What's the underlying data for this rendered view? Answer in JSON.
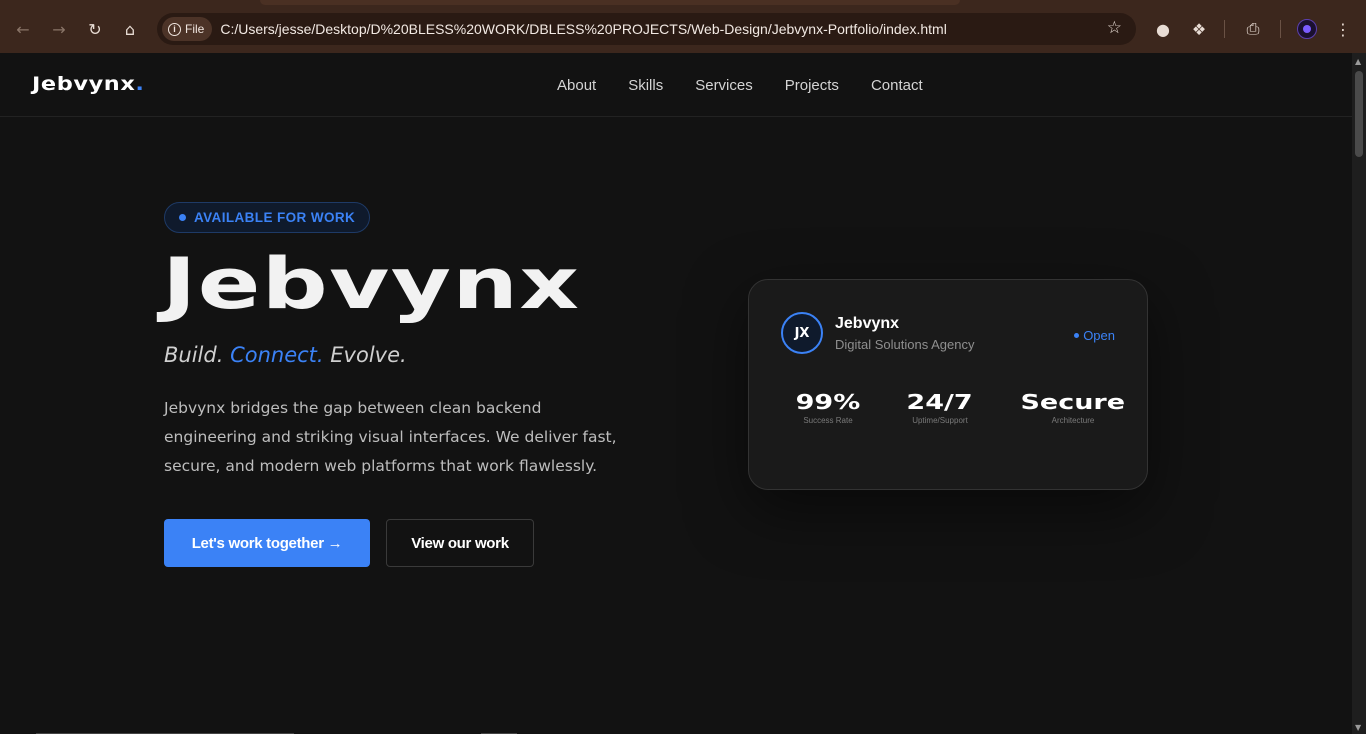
{
  "browser": {
    "chip_label": "File",
    "url": "C:/Users/jesse/Desktop/D%20BLESS%20WORK/DBLESS%20PROJECTS/Web-Design/Jebvynx-Portfolio/index.html",
    "theme_color": "#3c271d"
  },
  "site": {
    "logo": "Jebvynx",
    "logo_dot": ".",
    "nav": [
      "About",
      "Skills",
      "Services",
      "Projects",
      "Contact"
    ],
    "accent_color": "#3b82f6"
  },
  "hero": {
    "badge": "AVAILABLE FOR WORK",
    "title": "Jebvynx",
    "tagline_1": "Build.",
    "tagline_2": "Connect.",
    "tagline_3": "Evolve.",
    "description": "Jebvynx bridges the gap between clean backend engineering and striking visual interfaces. We deliver fast, secure, and modern web platforms that work flawlessly.",
    "primary_button": "Let's work together →",
    "secondary_button": "View our work"
  },
  "card": {
    "avatar_initials": "JX",
    "name": "Jebvynx",
    "subtitle": "Digital Solutions Agency",
    "status": "Open",
    "stats": [
      {
        "value": "99%",
        "label": "Success Rate"
      },
      {
        "value": "24/7",
        "label": "Uptime/Support"
      },
      {
        "value": "Secure",
        "label": "Architecture"
      }
    ]
  }
}
